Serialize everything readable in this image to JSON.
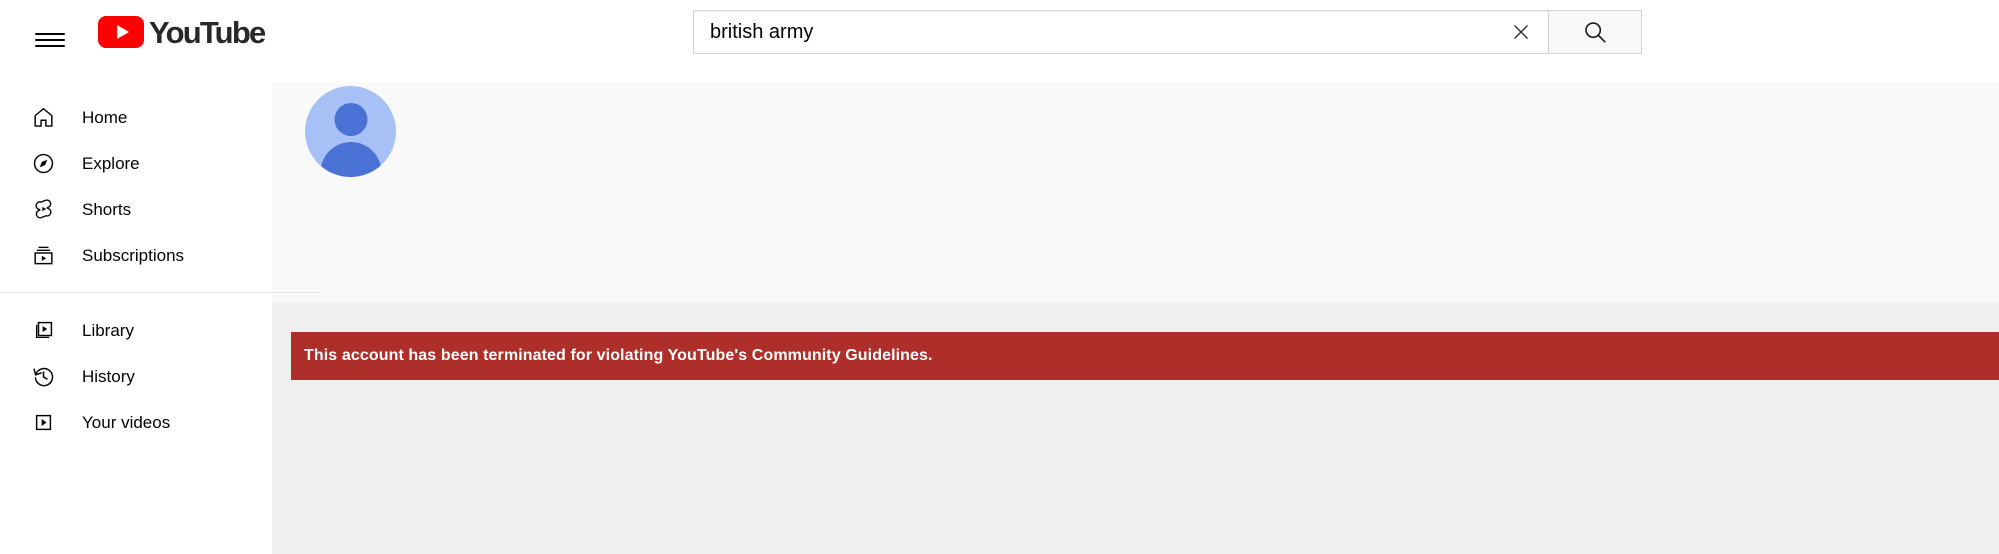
{
  "masthead": {
    "guide_toggle_name": "Guide",
    "logo_text": "YouTube",
    "logo_icon": "youtube-play-icon"
  },
  "search": {
    "value": "british army",
    "placeholder": "Search",
    "clear_icon": "close-icon",
    "search_icon": "search-icon"
  },
  "sidebar": {
    "primary_items": [
      {
        "label": "Home",
        "icon": "home-icon"
      },
      {
        "label": "Explore",
        "icon": "compass-icon"
      },
      {
        "label": "Shorts",
        "icon": "shorts-icon"
      },
      {
        "label": "Subscriptions",
        "icon": "subscriptions-icon"
      }
    ],
    "secondary_items": [
      {
        "label": "Library",
        "icon": "library-icon"
      },
      {
        "label": "History",
        "icon": "history-clock-icon"
      },
      {
        "label": "Your videos",
        "icon": "your-videos-icon"
      }
    ]
  },
  "channel": {
    "avatar_icon": "default-account-avatar"
  },
  "banner": {
    "message": "This account has been terminated for violating YouTube's Community Guidelines.",
    "background_color": "#ae2f29",
    "text_color": "#ffffff"
  }
}
